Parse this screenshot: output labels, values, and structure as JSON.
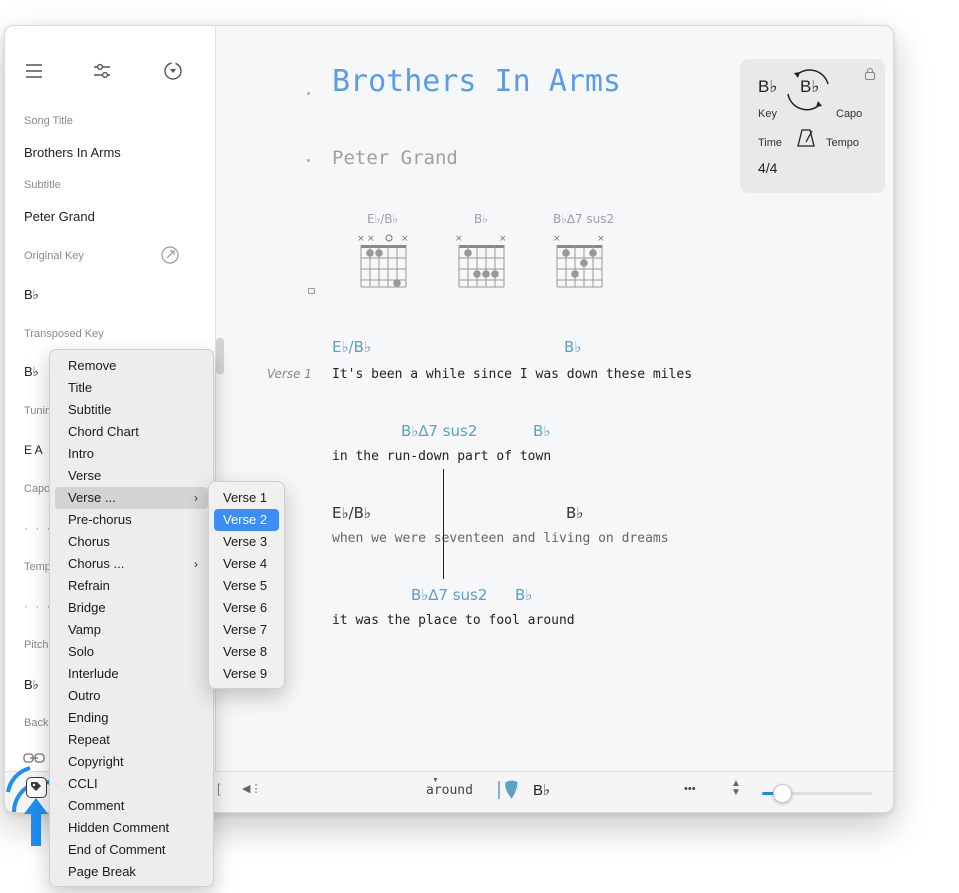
{
  "sidebar": {
    "fields": [
      {
        "label": "Song Title",
        "value": "Brothers In Arms"
      },
      {
        "label": "Subtitle",
        "value": "Peter Grand"
      },
      {
        "label": "Original Key",
        "value": "B♭"
      },
      {
        "label": "Transposed Key",
        "value": "B♭"
      }
    ],
    "partial_labels": [
      "Tunin",
      "Capo",
      "Temp",
      "Pitch",
      "Back"
    ],
    "tuning_value": "E A",
    "placeholder_dots": "· · ·",
    "pitch_value": "B♭"
  },
  "song": {
    "title": "Brothers In Arms",
    "subtitle": "Peter Grand",
    "chord_diagrams": [
      {
        "name": "E♭/B♭"
      },
      {
        "name": "B♭"
      },
      {
        "name": "B♭∆7 sus2"
      }
    ],
    "verse_label": "Verse 1",
    "lines": [
      {
        "lyric": "It's been a while since I was down these miles",
        "chords": [
          "E♭/B♭",
          "B♭"
        ]
      },
      {
        "lyric": "in the run-down part of town",
        "chords": [
          "B♭∆7 sus2",
          "B♭"
        ]
      },
      {
        "lyric": "when we were seventeen and living on dreams",
        "chords": [
          "E♭/B♭",
          "B♭"
        ]
      },
      {
        "lyric": "it was the place to fool around",
        "chords": [
          "B♭∆7 sus2",
          "B♭"
        ]
      }
    ]
  },
  "info_panel": {
    "key_value": "B♭",
    "key_label": "Key",
    "capo_value": "B♭",
    "capo_label": "Capo",
    "time_label": "Time",
    "tempo_label": "Tempo",
    "time_value": "4/4"
  },
  "bottom_bar": {
    "word": "around",
    "chord": "B♭",
    "more": "•••",
    "zoom_fraction": 0.12
  },
  "context_menu": {
    "items": [
      "Remove",
      "Title",
      "Subtitle",
      "Chord Chart",
      "Intro",
      "Verse",
      "Verse ...",
      "Pre-chorus",
      "Chorus",
      "Chorus  ...",
      "Refrain",
      "Bridge",
      "Vamp",
      "Solo",
      "Interlude",
      "Outro",
      "Ending",
      "Repeat",
      "Copyright",
      "CCLI",
      "Comment",
      "Hidden Comment",
      "End of Comment",
      "Page Break"
    ],
    "highlighted": "Verse ...",
    "submenu_items": [
      "Verse 1",
      "Verse 2",
      "Verse 3",
      "Verse 4",
      "Verse 5",
      "Verse 6",
      "Verse 7",
      "Verse 8",
      "Verse 9"
    ],
    "submenu_selected": "Verse 2"
  },
  "colors": {
    "title_blue": "#5b9ce8",
    "chord_blue": "#5c9fc7",
    "selection_blue": "#3d8ef4",
    "highlight_circle": "#1e8ff0"
  }
}
